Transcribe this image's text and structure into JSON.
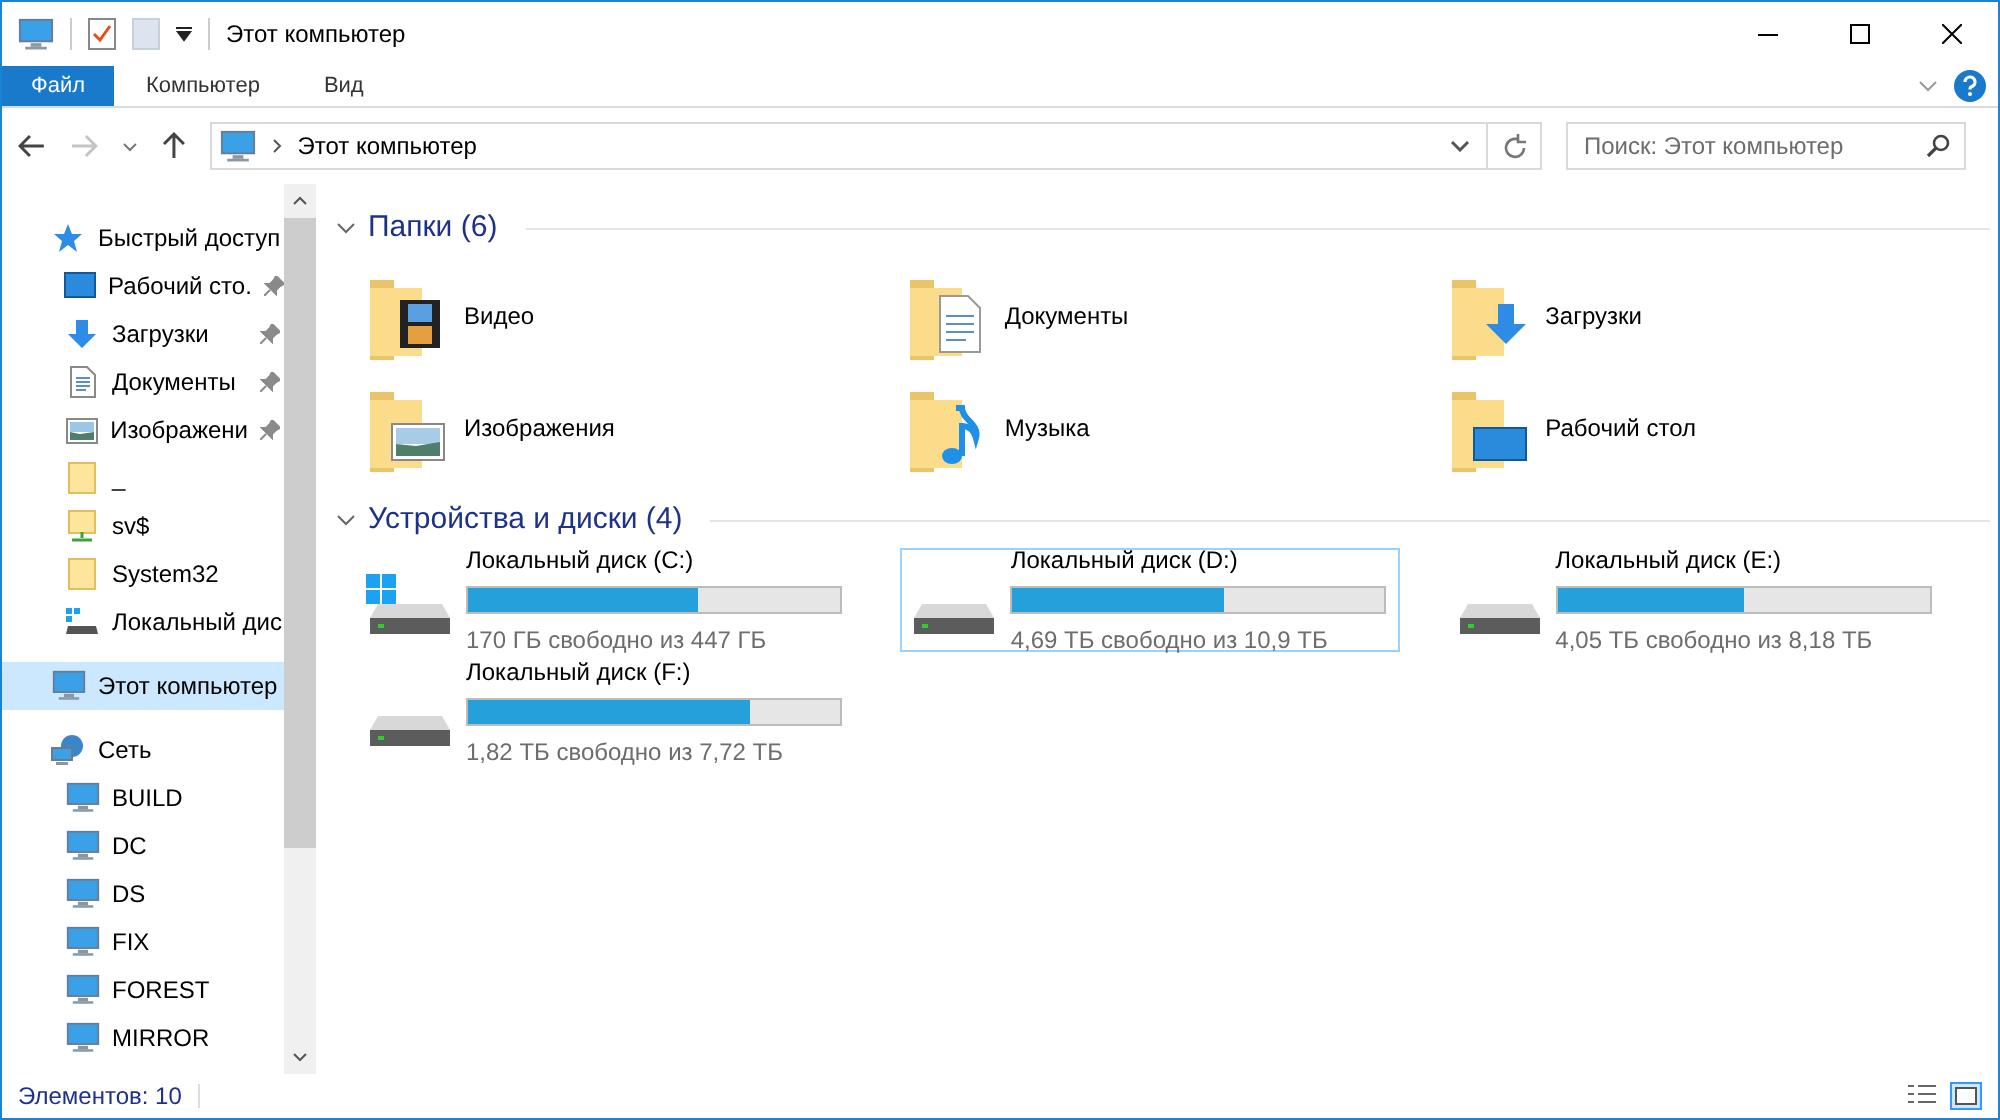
{
  "window": {
    "title": "Этот компьютер"
  },
  "ribbon_tabs": [
    {
      "label": "Файл",
      "selected": true
    },
    {
      "label": "Компьютер",
      "selected": false
    },
    {
      "label": "Вид",
      "selected": false
    }
  ],
  "address": {
    "path": "Этот компьютер"
  },
  "search": {
    "placeholder": "Поиск: Этот компьютер"
  },
  "sidebar": {
    "items": [
      {
        "label": "Быстрый доступ",
        "kind": "star",
        "selected": false,
        "children": [
          {
            "label": "Рабочий сто.",
            "kind": "desktop",
            "pinned": true,
            "selected": false
          },
          {
            "label": "Загрузки",
            "kind": "download",
            "pinned": true,
            "selected": false
          },
          {
            "label": "Документы",
            "kind": "document",
            "pinned": true,
            "selected": false
          },
          {
            "label": "Изображени",
            "kind": "picture",
            "pinned": true,
            "selected": false
          },
          {
            "label": "_",
            "kind": "folder",
            "pinned": false,
            "selected": false
          },
          {
            "label": "sv$",
            "kind": "share",
            "pinned": false,
            "selected": false
          },
          {
            "label": "System32",
            "kind": "folder",
            "pinned": false,
            "selected": false
          },
          {
            "label": "Локальный дис",
            "kind": "drive",
            "pinned": false,
            "selected": false
          }
        ]
      },
      {
        "label": "Этот компьютер",
        "kind": "computer",
        "selected": true
      },
      {
        "label": "Сеть",
        "kind": "network",
        "selected": false,
        "children": [
          {
            "label": "BUILD",
            "kind": "computer",
            "selected": false
          },
          {
            "label": "DC",
            "kind": "computer",
            "selected": false
          },
          {
            "label": "DS",
            "kind": "computer",
            "selected": false
          },
          {
            "label": "FIX",
            "kind": "computer",
            "selected": false
          },
          {
            "label": "FOREST",
            "kind": "computer",
            "selected": false
          },
          {
            "label": "MIRROR",
            "kind": "computer",
            "selected": false
          }
        ]
      }
    ]
  },
  "folders": {
    "title": "Папки (6)",
    "expanded": true,
    "items": [
      {
        "label": "Видео",
        "kind": "video"
      },
      {
        "label": "Документы",
        "kind": "document"
      },
      {
        "label": "Загрузки",
        "kind": "download"
      },
      {
        "label": "Изображения",
        "kind": "picture"
      },
      {
        "label": "Музыка",
        "kind": "music"
      },
      {
        "label": "Рабочий стол",
        "kind": "desktop"
      }
    ]
  },
  "drives": {
    "title": "Устройства и диски (4)",
    "expanded": true,
    "items": [
      {
        "label": "Локальный диск (C:)",
        "kind": "system",
        "level": 0.62,
        "free": "170 ГБ свободно из 447 ГБ",
        "selected": false
      },
      {
        "label": "Локальный диск (D:)",
        "kind": "drive",
        "level": 0.57,
        "free": "4,69 ТБ свободно из 10,9 ТБ",
        "selected": true
      },
      {
        "label": "Локальный диск (E:)",
        "kind": "drive",
        "level": 0.5,
        "free": "4,05 ТБ свободно из 8,18 ТБ",
        "selected": false
      },
      {
        "label": "Локальный диск (F:)",
        "kind": "drive",
        "level": 0.76,
        "free": "1,82 ТБ свободно из 7,72 ТБ",
        "selected": false
      }
    ]
  },
  "status_bar": {
    "count": "Элементов: 10"
  }
}
